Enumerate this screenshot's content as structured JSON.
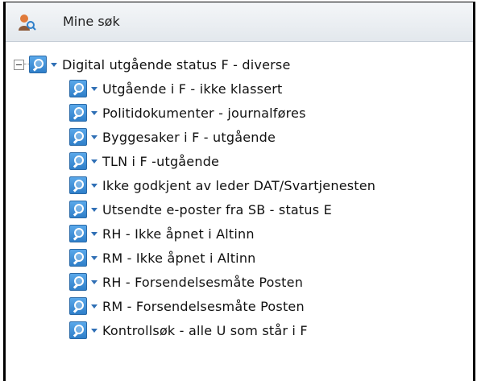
{
  "header": {
    "title": "Mine søk",
    "icon": "user-search-icon"
  },
  "tree": {
    "root": {
      "label": "Digital utgående status F - diverse",
      "expanded": true
    },
    "children": [
      {
        "label": "Utgående i F - ikke klassert"
      },
      {
        "label": "Politidokumenter - journalføres"
      },
      {
        "label": "Byggesaker i F - utgående"
      },
      {
        "label": "TLN i F -utgående"
      },
      {
        "label": "Ikke godkjent av leder DAT/Svartjenesten"
      },
      {
        "label": "Utsendte e-poster fra SB - status E"
      },
      {
        "label": "RH - Ikke åpnet i Altinn"
      },
      {
        "label": "RM - Ikke åpnet i Altinn"
      },
      {
        "label": "RH - Forsendelsesmåte Posten"
      },
      {
        "label": "RM - Forsendelsesmåte Posten"
      },
      {
        "label": "Kontrollsøk - alle U som står i F"
      }
    ]
  },
  "colors": {
    "header_bg": "#e8ecf0",
    "icon_blue": "#3a8ad6",
    "caret_blue": "#2f6fb5"
  }
}
